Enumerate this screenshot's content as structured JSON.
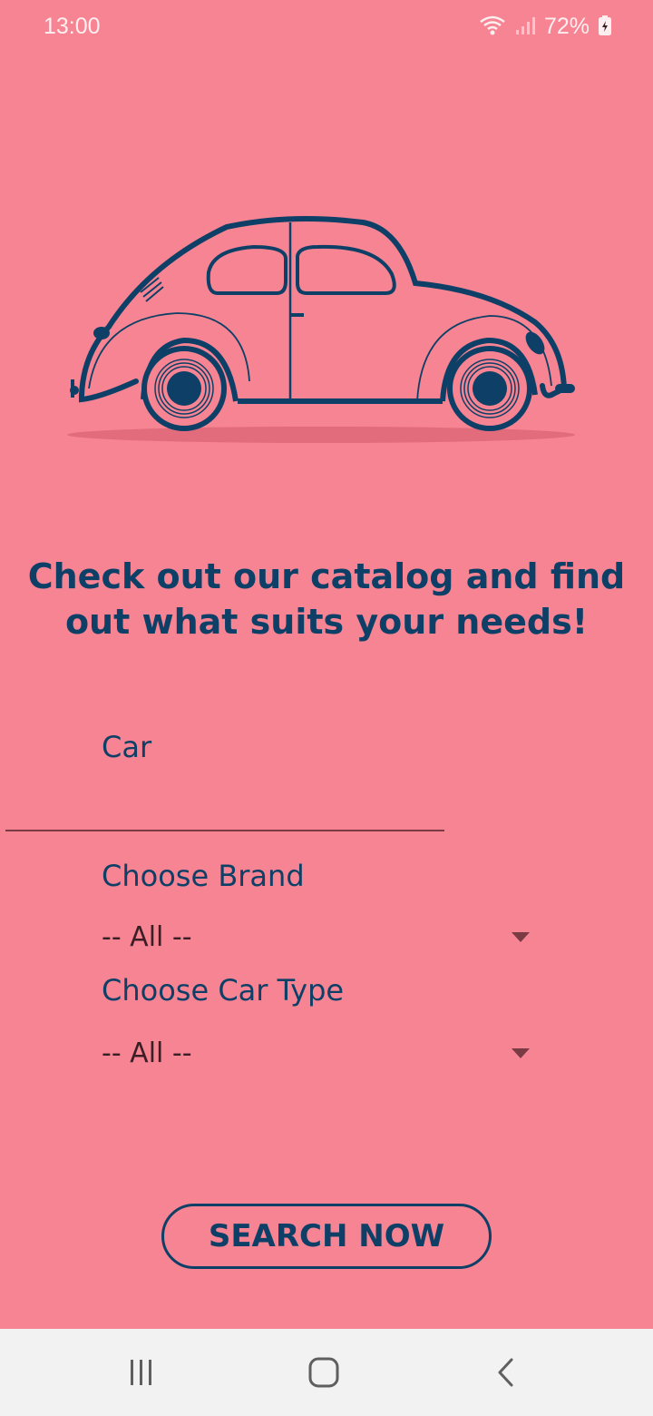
{
  "status_bar": {
    "time": "13:00",
    "battery": "72%",
    "icons": [
      "wifi-icon",
      "signal-icon",
      "battery-charging-icon"
    ]
  },
  "illustration": {
    "name": "car-illustration",
    "colors": {
      "stroke": "#0e3f66",
      "shadow": "#e26b7c"
    }
  },
  "headline": {
    "line1": "Check out our catalog and find",
    "line2": "out what suits your needs!"
  },
  "form": {
    "car_label": "Car",
    "car_value": "",
    "brand_label": "Choose Brand",
    "brand_selected": "-- All --",
    "type_label": "Choose Car Type",
    "type_selected": "-- All --"
  },
  "search_button_label": "SEARCH NOW",
  "nav_bar": {
    "icons": [
      "recents-icon",
      "home-icon",
      "back-icon"
    ]
  },
  "colors": {
    "background": "#f78493",
    "accent": "#0e3f66",
    "nav_bg": "#f2f2f2"
  }
}
